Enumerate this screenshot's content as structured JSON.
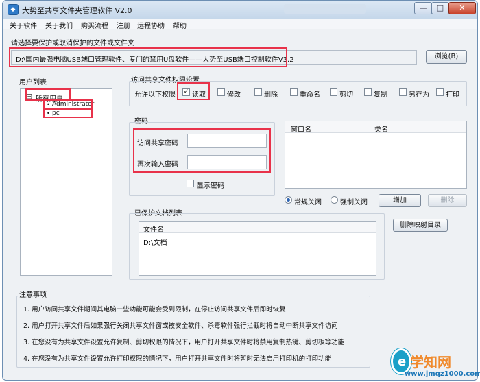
{
  "window": {
    "title": "大势至共享文件夹管理软件 V2.0",
    "min_glyph": "—",
    "max_glyph": "□",
    "close_glyph": "✕"
  },
  "menu": [
    "关于软件",
    "关于我们",
    "购买流程",
    "注册",
    "远程协助",
    "帮助"
  ],
  "select_prompt": "请选择要保护或取消保护的文件或文件夹",
  "path_value": "D:\\国内最强电脑USB端口管理软件、专门的禁用U盘软件——大势至USB端口控制软件V3.2",
  "browse_label": "浏览(B)",
  "users": {
    "heading": "用户列表",
    "root_toggle": "⊟",
    "root": "所有用户",
    "children": [
      "Administrator",
      "pc"
    ]
  },
  "permissions": {
    "heading": "访问共享文件权限设置",
    "allow_label": "允许以下权限",
    "checkmark": "✓",
    "items": [
      {
        "label": "读取",
        "checked": true
      },
      {
        "label": "修改",
        "checked": false
      },
      {
        "label": "删除",
        "checked": false
      },
      {
        "label": "重命名",
        "checked": false
      },
      {
        "label": "剪切",
        "checked": false
      },
      {
        "label": "复制",
        "checked": false
      },
      {
        "label": "另存为",
        "checked": false
      },
      {
        "label": "打印",
        "checked": false
      }
    ]
  },
  "password": {
    "heading": "密码",
    "access_label": "访问共享密码",
    "access_value": "",
    "confirm_label": "再次输入密码",
    "confirm_value": "",
    "show_label": "显示密码"
  },
  "window_list": {
    "columns": [
      "窗口名",
      "类名"
    ],
    "rows": []
  },
  "close_mode": {
    "normal_label": "常规关闭",
    "force_label": "强制关闭",
    "selected": "normal"
  },
  "add_label": "增加",
  "delete_label": "删除",
  "protected": {
    "heading": "已保护文档列表",
    "column": "文件名",
    "rows": [
      "D:\\文档"
    ]
  },
  "delete_map_label": "删除映射目录",
  "notes": {
    "heading": "注意事项",
    "items": [
      "1. 用户访问共享文件期间其电脑一些功能可能会受到限制，在停止访问共享文件后即时恢复",
      "2. 用户打开共享文件后如果强行关闭共享文件窗或被安全软件、杀毒软件强行拦截时将自动中断共享文件访问",
      "3. 在您没有为共享文件设置允许复制、剪切权限的情况下，用户打开共享文件时将禁用复制热键、剪切板等功能",
      "4. 在您没有为共享文件设置允许打印权限的情况下，用户打开共享文件时将暂时无法启用打印机的打印功能"
    ]
  },
  "watermark": {
    "logo_char": "e",
    "title": "学知网",
    "url": "www.jmqz1000.com"
  },
  "colors": {
    "highlight_red": "#e8324a",
    "window_bg": "#eef1f4"
  }
}
